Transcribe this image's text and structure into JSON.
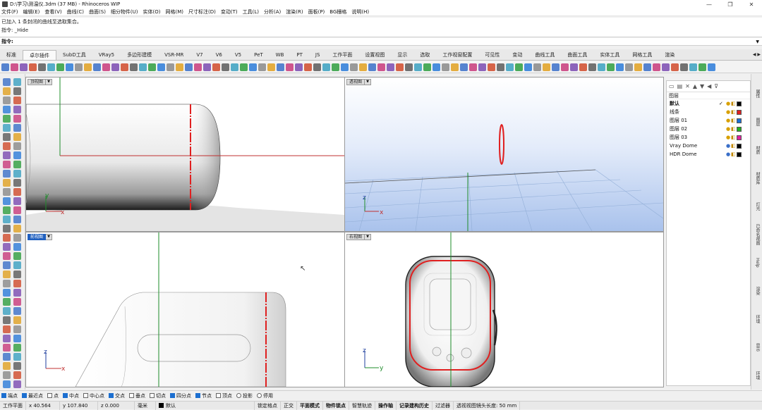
{
  "window": {
    "title": "D:\\学习\\测温仪.3dm (37 MB) - Rhinoceros WIP",
    "controls": [
      "—",
      "❐",
      "✕"
    ]
  },
  "menu": [
    "文件(F)",
    "编辑(E)",
    "查看(V)",
    "曲线(C)",
    "曲面(S)",
    "细分物件(U)",
    "实体(O)",
    "网格(M)",
    "尺寸标注(D)",
    "变动(T)",
    "工具(L)",
    "分析(A)",
    "渲染(R)",
    "面板(P)",
    "BG栅格",
    "说明(H)"
  ],
  "history": {
    "line1": "已加入 1 条封闭的曲线至选取集合。",
    "line2": "指令: _Hide"
  },
  "command": {
    "label": "指令:"
  },
  "tabs": [
    "标准",
    "卓尔插件",
    "SubD工具",
    "VRay5",
    "多边形建模",
    "VSR-MR",
    "V7",
    "V6",
    "V5",
    "PeT",
    "WB",
    "PT",
    "JS",
    "工作平面",
    "设置视图",
    "显示",
    "选取",
    "工作视窗配置",
    "可见性",
    "变动",
    "曲线工具",
    "曲面工具",
    "实体工具",
    "网格工具",
    "渲染"
  ],
  "active_tab_index": 1,
  "viewports": {
    "top": {
      "label": "顶视图",
      "x_axis": "x",
      "y_axis": "y"
    },
    "perspective": {
      "label": "透视图",
      "x_axis": "x",
      "z_axis": "z"
    },
    "front": {
      "label": "前视图",
      "x_axis": "x",
      "z_axis": "z"
    },
    "right": {
      "label": "右视图",
      "y_axis": "y",
      "z_axis": "z"
    }
  },
  "layers": {
    "header": "图层",
    "rows": [
      {
        "name": "默认",
        "current": true,
        "color": "#000000",
        "bulb": "#d8a000"
      },
      {
        "name": "线条",
        "current": false,
        "color": "#e02020",
        "bulb": "#d8a000"
      },
      {
        "name": "图层 01",
        "current": false,
        "color": "#1a6fd6",
        "bulb": "#d8a000"
      },
      {
        "name": "图层 02",
        "current": false,
        "color": "#20b020",
        "bulb": "#d8a000"
      },
      {
        "name": "图层 03",
        "current": false,
        "color": "#e020a0",
        "bulb": "#d8a000"
      },
      {
        "name": "Vray Dome",
        "current": false,
        "color": "#000000",
        "bulb": "#3a6fc8"
      },
      {
        "name": "HDR Dome",
        "current": false,
        "color": "#000000",
        "bulb": "#3a6fc8"
      }
    ]
  },
  "right_tabs": [
    "属性",
    "图层",
    "材质",
    "材质库",
    "灯光",
    "已命名视图",
    "Help",
    "渲染",
    "环境",
    "显示",
    "环境"
  ],
  "osnaps": [
    {
      "label": "端点",
      "on": true
    },
    {
      "label": "最近点",
      "on": true
    },
    {
      "label": "点",
      "on": false
    },
    {
      "label": "中点",
      "on": true
    },
    {
      "label": "中心点",
      "on": false
    },
    {
      "label": "交点",
      "on": true
    },
    {
      "label": "垂点",
      "on": false
    },
    {
      "label": "切点",
      "on": false
    },
    {
      "label": "四分点",
      "on": true
    },
    {
      "label": "节点",
      "on": true
    },
    {
      "label": "顶点",
      "on": false
    },
    {
      "label": "投影",
      "radio": true
    },
    {
      "label": "停用",
      "radio": true
    }
  ],
  "status": {
    "cplane": "工作平面",
    "x": "x 40.564",
    "y": "y 107.840",
    "z": "z 0.000",
    "unit": "毫米",
    "layer": "默认",
    "items": [
      "锁定格点",
      "正交",
      "平面模式",
      "物件锁点",
      "智慧轨迹",
      "操作轴",
      "记录建构历史",
      "过滤器",
      "透视视图镜头长度: 50 mm"
    ],
    "bold": [
      false,
      false,
      true,
      true,
      false,
      true,
      true,
      false,
      false
    ]
  },
  "colors": {
    "accent": "#1f5fbf",
    "curve_red": "#e02020",
    "axis_green": "#1e8c2a"
  }
}
